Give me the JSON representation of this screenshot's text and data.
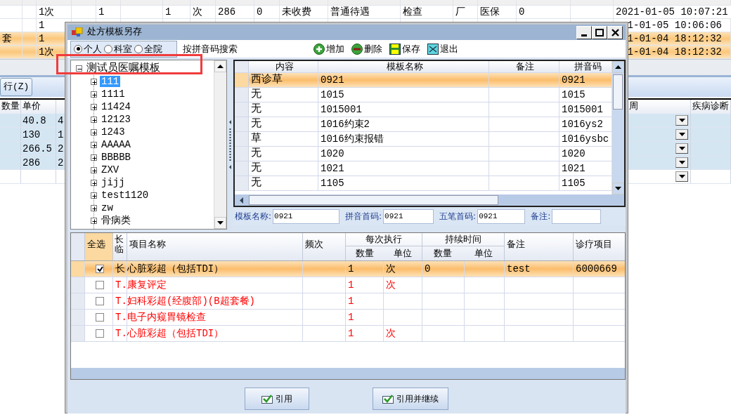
{
  "background_table": {
    "rows": [
      {
        "selected": false
      },
      {
        "selected": false,
        "column_3": "1次",
        "column_5": "1",
        "column_7": "1",
        "column_8": "次",
        "column_9": "286",
        "column_10": "0",
        "column_11": "未收费",
        "column_12": "普通待遇",
        "column_13": "检查",
        "column_14": "厂",
        "column_15": "医保",
        "column_16": "0",
        "column_18": "2021-01-05 10:07:21"
      },
      {
        "selected": false,
        "column_3": "1",
        "column_18": "1-01-05 10:06:06"
      },
      {
        "selected": true,
        "column_1": "套",
        "column_3": "1",
        "column_18": "1-01-04 18:12:32"
      },
      {
        "selected": true,
        "column_3": "1次",
        "column_18": "1-01-04 18:12:32"
      }
    ]
  },
  "background_toolbar": {
    "button": "行(Z)"
  },
  "background_grid": {
    "columns": {
      "column_1": "数量",
      "column_2": "单价",
      "column_4": "周",
      "column_5": "疾病诊断"
    },
    "rows": [
      {
        "selected": true,
        "column_2": "40.8",
        "column_3": "4"
      },
      {
        "selected": true,
        "column_2": "130",
        "column_3": "1"
      },
      {
        "selected": true,
        "column_2": "266.5",
        "column_3": "2"
      },
      {
        "selected": true,
        "column_2": "286",
        "column_3": "2"
      },
      {
        "selected": false
      }
    ]
  },
  "dialog": {
    "title": "处方模板另存",
    "scope_options": [
      {
        "label": "个人",
        "selected": true
      },
      {
        "label": "科室",
        "selected": false
      },
      {
        "label": "全院",
        "selected": false
      }
    ],
    "search_label": "按拼音码搜索",
    "toolbar_buttons": [
      {
        "kind": "add",
        "label": "增加"
      },
      {
        "kind": "delete",
        "label": "删除"
      },
      {
        "kind": "save",
        "label": "保存"
      },
      {
        "kind": "exit",
        "label": "退出"
      }
    ],
    "tree": {
      "label": "测试员医嘱模板",
      "expanded": true,
      "selected": false,
      "children": [
        {
          "label": "111",
          "expanded": false,
          "selected": true
        },
        {
          "label": "1111",
          "expanded": false,
          "selected": false
        },
        {
          "label": "11424",
          "expanded": false,
          "selected": false
        },
        {
          "label": "12123",
          "expanded": false,
          "selected": false
        },
        {
          "label": "1243",
          "expanded": false,
          "selected": false
        },
        {
          "label": "AAAAA",
          "expanded": false,
          "selected": false
        },
        {
          "label": "BBBBB",
          "expanded": false,
          "selected": false
        },
        {
          "label": "ZXV",
          "expanded": false,
          "selected": false
        },
        {
          "label": "jijj",
          "expanded": false,
          "selected": false
        },
        {
          "label": "test1120",
          "expanded": false,
          "selected": false
        },
        {
          "label": "zw",
          "expanded": false,
          "selected": false
        },
        {
          "label": "骨病类",
          "expanded": false,
          "selected": false
        }
      ]
    },
    "template_table": {
      "columns": [
        "内容",
        "模板名称",
        "备注",
        "拼音码"
      ],
      "rows": [
        {
          "selected": true,
          "content": "西诊草",
          "name": "0921",
          "pinyin": "0921"
        },
        {
          "selected": false,
          "content": "无",
          "name": "1015",
          "pinyin": "1015"
        },
        {
          "selected": false,
          "content": "无",
          "name": "1015001",
          "pinyin": "1015001"
        },
        {
          "selected": false,
          "content": "无",
          "name": "1016约束2",
          "pinyin": "1016ys2"
        },
        {
          "selected": false,
          "content": "草",
          "name": "1016约束报错",
          "pinyin": "1016ysbc"
        },
        {
          "selected": false,
          "content": "无",
          "name": "1020",
          "pinyin": "1020"
        },
        {
          "selected": false,
          "content": "无",
          "name": "1021",
          "pinyin": "1021"
        },
        {
          "selected": false,
          "content": "无",
          "name": "1105",
          "pinyin": "1105"
        }
      ]
    },
    "form": [
      {
        "label": "模板名称:",
        "value": "0921"
      },
      {
        "label": "拼音首码:",
        "value": "0921"
      },
      {
        "label": "五笔首码:",
        "value": "0921"
      },
      {
        "label": "备注:"
      }
    ],
    "items_table": {
      "columns": {
        "select_all": "全选",
        "long_temp": "长临",
        "name": "项目名称",
        "frequency": "频次",
        "per_time": "每次执行",
        "per_qty": "数量",
        "per_unit": "单位",
        "duration": "持续时间",
        "dur_qty": "数量",
        "dur_unit": "单位",
        "note": "备注",
        "code": "诊疗项目"
      },
      "rows": [
        {
          "selected": true,
          "checked": true,
          "kind": "long",
          "type": "长",
          "name": "心脏彩超（包括TDI）",
          "qty": "1",
          "unit": "次",
          "dur_qty": "0",
          "note": "test",
          "code": "6000669"
        },
        {
          "selected": false,
          "checked": false,
          "kind": "temporary",
          "type": "T.",
          "name": "康复评定",
          "qty": "1",
          "unit": "次"
        },
        {
          "selected": false,
          "checked": false,
          "kind": "temporary",
          "type": "T.",
          "name": "妇科彩超(经腹部)(B超套餐)",
          "qty": "1"
        },
        {
          "selected": false,
          "checked": false,
          "kind": "temporary",
          "type": "T.",
          "name": "电子内窥胃镜检查",
          "qty": "1"
        },
        {
          "selected": false,
          "checked": false,
          "kind": "temporary",
          "type": "T.",
          "name": "心脏彩超（包括TDI）",
          "qty": "1",
          "unit": "次"
        }
      ]
    },
    "buttons": [
      {
        "label": "引用"
      },
      {
        "label": "引用并继续"
      }
    ]
  }
}
